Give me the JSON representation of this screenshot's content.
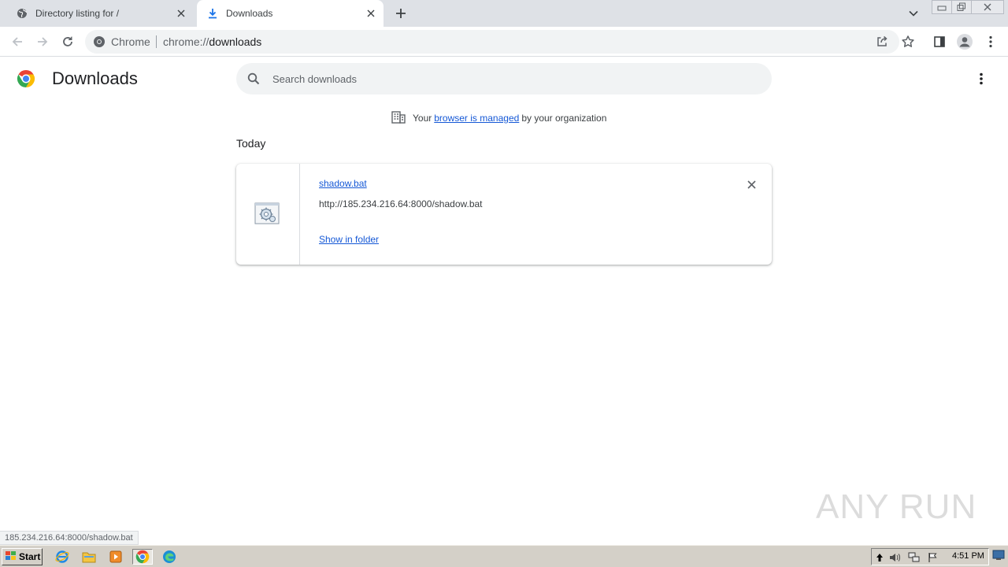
{
  "tabs": [
    {
      "label": "Directory listing for /",
      "icon": "globe-icon",
      "active": false
    },
    {
      "label": "Downloads",
      "icon": "download-icon",
      "active": true
    }
  ],
  "omnibox": {
    "scheme_label": "Chrome",
    "url_prefix": "chrome://",
    "url_host": "downloads"
  },
  "page": {
    "title": "Downloads",
    "search_placeholder": "Search downloads",
    "managed": {
      "prefix": "Your",
      "link": "browser is managed",
      "suffix": "by your organization"
    },
    "section_label": "Today"
  },
  "downloads": [
    {
      "file_name": "shadow.bat",
      "url": "http://185.234.216.64:8000/shadow.bat",
      "action_label": "Show in folder",
      "file_icon": "batch-file-icon"
    }
  ],
  "status_bar": "185.234.216.64:8000/shadow.bat",
  "watermark": "ANY RUN",
  "taskbar": {
    "start_label": "Start",
    "clock": "4:51 PM"
  },
  "colors": {
    "link": "#1558d6",
    "tabstrip": "#dee1e6",
    "omnibox": "#f1f3f4",
    "taskbar": "#d4d0c8"
  }
}
